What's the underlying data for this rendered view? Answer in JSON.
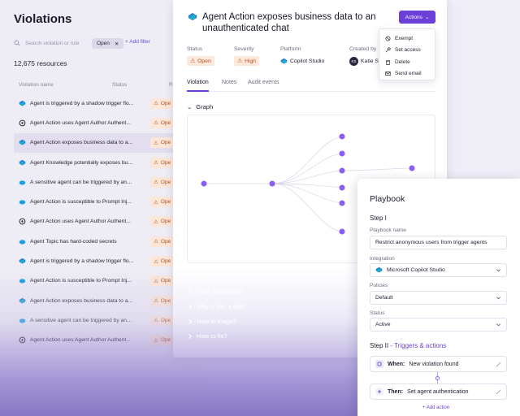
{
  "left": {
    "title": "Violations",
    "search_placeholder": "Search violation or rule",
    "filter_chip": "Open",
    "add_filter": "+ Add filter",
    "count": "12,675 resources",
    "col_name": "Violation name",
    "col_status": "Status",
    "col_extra": "R",
    "rows": [
      {
        "name": "Agent is triggered by a shadow trigger flo...",
        "status": "Ope",
        "icon": "copilot"
      },
      {
        "name": "Agent Action uses Agent Author Authent...",
        "status": "Ope",
        "icon": "openai"
      },
      {
        "name": "Agent Action exposes business data to a...",
        "status": "Ope",
        "icon": "copilot"
      },
      {
        "name": "Agent Knowledge potentially exposes bu...",
        "status": "Ope",
        "icon": "copilot"
      },
      {
        "name": "A sensitive agent can be triggered by ano...",
        "status": "Ope",
        "icon": "salesforce"
      },
      {
        "name": "Agent Action is susceptible to Prompt Inj...",
        "status": "Ope",
        "icon": "salesforce"
      },
      {
        "name": "Agent Action uses Agent Author Authent...",
        "status": "Ope",
        "icon": "openai"
      },
      {
        "name": "Agent Topic has hard-coded secrets",
        "status": "Ope",
        "icon": "salesforce"
      },
      {
        "name": "Agent is triggered by a shadow trigger flo...",
        "status": "Ope",
        "icon": "copilot"
      },
      {
        "name": "Agent Action is susceptible to Prompt Inj...",
        "status": "Ope",
        "icon": "salesforce"
      },
      {
        "name": "Agent Action exposes business data to a...",
        "status": "Ope",
        "icon": "copilot"
      },
      {
        "name": "A sensitive agent can be triggered by ano...",
        "status": "Ope",
        "icon": "salesforce"
      },
      {
        "name": "Agent Action uses Agent Author Authent...",
        "status": "Ope",
        "icon": "openai"
      }
    ]
  },
  "detail": {
    "title": "Agent Action exposes business data to an unauthenticated chat",
    "actions_label": "Actions",
    "menu": [
      "Exempt",
      "Set access",
      "Delete",
      "Send email"
    ],
    "status_label": "Status",
    "status_value": "Open",
    "severity_label": "Severity",
    "severity_value": "High",
    "platform_label": "Platform",
    "platform_value": "Copilot Studio",
    "created_label": "Created by",
    "created_value": "Katie S",
    "created_initials": "KS",
    "tabs": [
      "Violation",
      "Notes",
      "Audit events"
    ],
    "graph_label": "Graph",
    "accordion": [
      "What happened?",
      "Why is this a risk?",
      "How to triage?",
      "How to fix?"
    ]
  },
  "playbook": {
    "title": "Playbook",
    "step1": "Step I",
    "name_label": "Playbook name",
    "name_value": "Restrict anonymous users from trigger agents",
    "integration_label": "Integration",
    "integration_value": "Microsoft Copilot Studio",
    "policies_label": "Policies",
    "policies_value": "Default",
    "status_label": "Status",
    "status_value": "Active",
    "step2": "Step II",
    "step2_sub": " - Triggers & actions",
    "when_label": "When:",
    "when_value": "New violation found",
    "then_label": "Then:",
    "then_value": "Set agent authentication",
    "add_action": "+ Add action"
  },
  "colors": {
    "accent": "#6b3fd8",
    "status_bg": "#fde8dc",
    "status_fg": "#b4531f"
  }
}
